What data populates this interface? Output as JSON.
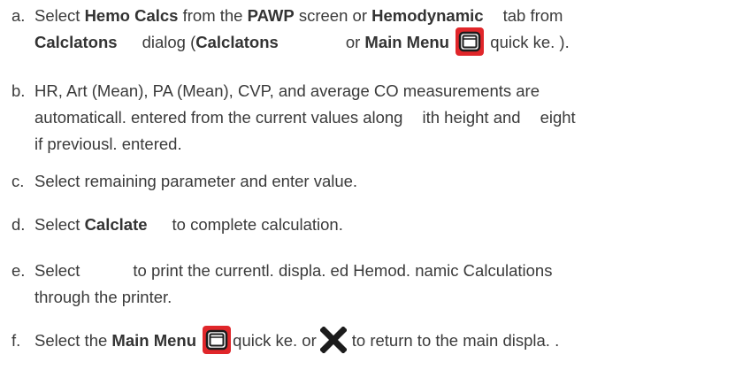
{
  "steps": {
    "a": {
      "marker": "a.",
      "t1": "Select ",
      "b1": "Hemo Calcs",
      "t2": " from the ",
      "b2": "PAWP",
      "t3": " screen or ",
      "b3": "Hemodynamic",
      "t4": "tab from",
      "b4": "Calclatons",
      "t5": "dialog (",
      "b5": "Calclatons",
      "t6": "or ",
      "b6": "Main Menu",
      "t7": " quick ke. )."
    },
    "b": {
      "marker": "b.",
      "line1": "HR, Art (Mean), PA (Mean), CVP, and average CO measurements are",
      "line2a": "automaticall. entered from the current values along",
      "line2b": "ith height and",
      "line2c": "eight",
      "line3": "if previousl. entered."
    },
    "c": {
      "marker": "c.",
      "text": "Select remaining parameter and enter value."
    },
    "d": {
      "marker": "d.",
      "t1": "Select ",
      "b1": "Calclate",
      "t2": "to complete calculation."
    },
    "e": {
      "marker": "e.",
      "t1": "Select",
      "t2": "to print the currentl. displa. ed Hemod. namic Calculations",
      "line2": "through the printer."
    },
    "f": {
      "marker": "f.",
      "t1": "Select the ",
      "b1": "Main Menu",
      "t2": "quick ke. or",
      "t3": "to return to the main displa. ."
    }
  },
  "icons": {
    "main_menu_icon": "main-menu-icon",
    "close_icon": "close-x-icon",
    "icon_bg": "#e0262a",
    "icon_frame": "#1c1c1c"
  }
}
